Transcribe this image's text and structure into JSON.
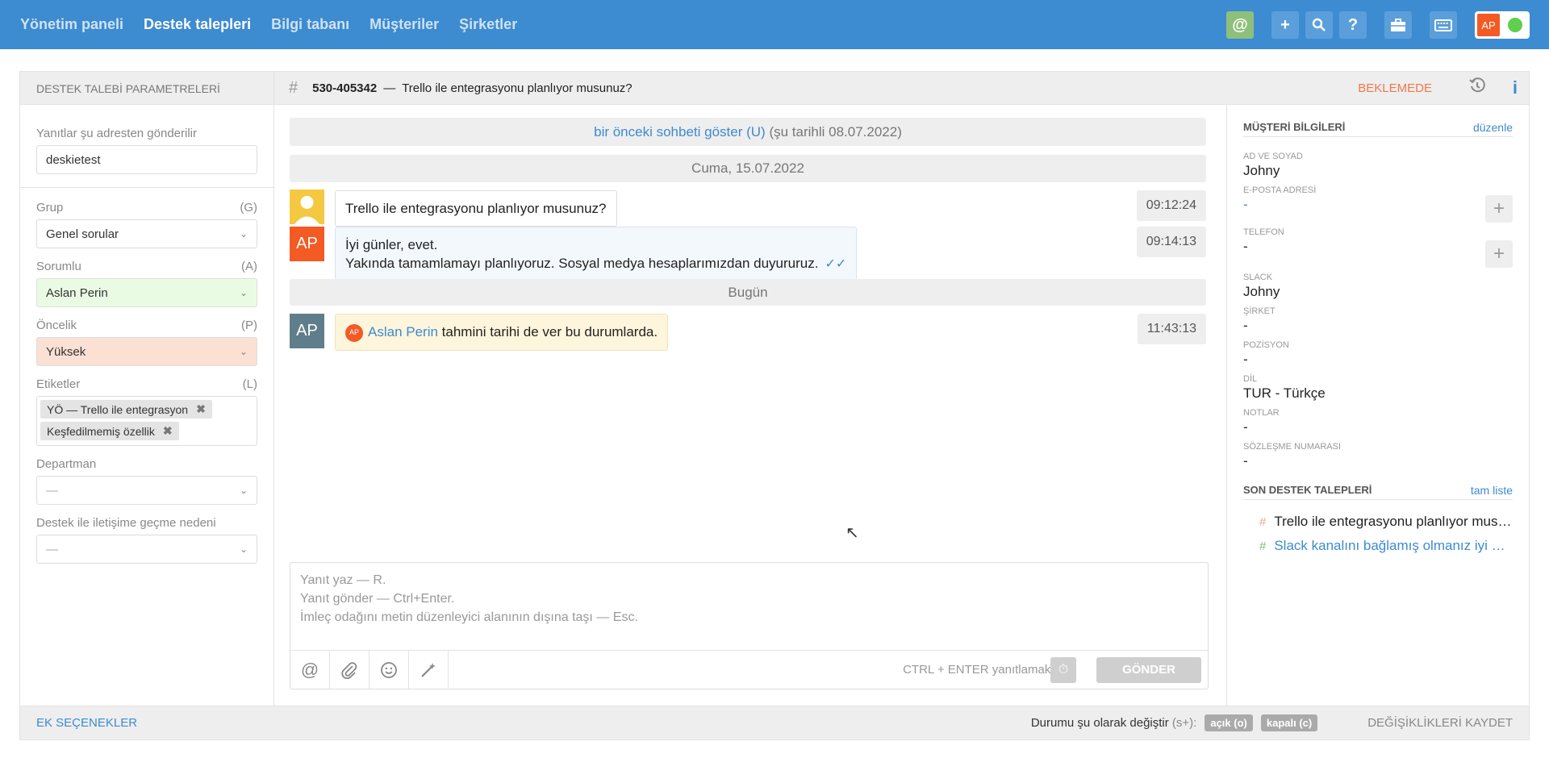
{
  "nav": {
    "items": [
      "Yönetim paneli",
      "Destek talepleri",
      "Bilgi tabanı",
      "Müşteriler",
      "Şirketler"
    ],
    "active": "Destek talepleri"
  },
  "topbar": {
    "user_initials": "AP",
    "icons": [
      "at-icon",
      "plus-icon",
      "search-icon",
      "help-icon",
      "briefcase-icon",
      "keyboard-icon"
    ],
    "online_color": "#5ecf4e",
    "brand_color": "#3d8bd0"
  },
  "left": {
    "header": "DESTEK TALEBİ PARAMETRELERİ",
    "reply_from_label": "Yanıtlar şu adresten gönderilir",
    "reply_from_value": "deskietest",
    "group_label": "Grup",
    "group_key": "(G)",
    "group_value": "Genel sorular",
    "assignee_label": "Sorumlu",
    "assignee_key": "(A)",
    "assignee_value": "Aslan Perin",
    "priority_label": "Öncelik",
    "priority_key": "(P)",
    "priority_value": "Yüksek",
    "tags_label": "Etiketler",
    "tags_key": "(L)",
    "tags": [
      "YÖ — Trello ile entegrasyon",
      "Keşfedilmemiş özellik"
    ],
    "department_label": "Departman",
    "department_value": "—",
    "reason_label": "Destek ile iletişime geçme nedeni",
    "reason_value": "—",
    "footer": "EK SEÇENEKLER"
  },
  "ticket": {
    "id": "530-405342",
    "separator": "—",
    "title": "Trello ile entegrasyonu planlıyor musunuz?",
    "status": "BEKLEMEDE"
  },
  "chat": {
    "prev_link": "bir önceki sohbeti göster (U)",
    "prev_date": "(şu tarihli 08.07.2022)",
    "date1": "Cuma, 15.07.2022",
    "date2": "Bugün",
    "messages": [
      {
        "text": "Trello ile entegrasyonu planlıyor musunuz?",
        "time": "09:12:24"
      },
      {
        "initials": "AP",
        "line1": "İyi günler, evet.",
        "line2": "Yakında tamamlamayı planlıyoruz. Sosyal medya hesaplarımızdan duyururuz.",
        "time": "09:14:13"
      },
      {
        "initials": "AP",
        "mini": "AP",
        "mention": "Aslan Perin",
        "text": "tahmini tarihi de ver bu durumlarda.",
        "time": "11:43:13"
      }
    ]
  },
  "composer": {
    "ph1": "Yanıt yaz — R.",
    "ph2": "Yanıt gönder — Ctrl+Enter.",
    "ph3": "İmleç odağını metin düzenleyici alanının dışına taşı — Esc.",
    "hint": "CTRL + ENTER yanıtlamak için",
    "send": "GÖNDER"
  },
  "customer": {
    "header": "MÜŞTERİ BİLGİLERİ",
    "edit": "düzenle",
    "fields": [
      {
        "key": "AD VE SOYAD",
        "value": "Johny"
      },
      {
        "key": "E-POSTA ADRESİ",
        "value": "-"
      },
      {
        "key": "TELEFON",
        "value": "-"
      },
      {
        "key": "SLACK",
        "value": "Johny"
      },
      {
        "key": "ŞİRKET",
        "value": "-"
      },
      {
        "key": "POZİSYON",
        "value": "-"
      },
      {
        "key": "DİL",
        "value": "TUR - Türkçe"
      },
      {
        "key": "NOTLAR",
        "value": "-"
      },
      {
        "key": "SÖZLEŞME NUMARASI",
        "value": "-"
      }
    ],
    "recent_header": "SON DESTEK TALEPLERİ",
    "recent_all": "tam liste",
    "recent": [
      "Trello ile entegrasyonu planlıyor musunuz?",
      "Slack kanalını bağlamış olmanız iyi oldu"
    ]
  },
  "bottom": {
    "change_label": "Durumu şu olarak değiştir",
    "change_key": "(s+):",
    "open": "açık (o)",
    "closed": "kapalı (c)",
    "save": "DEĞİŞİKLİKLERİ KAYDET"
  }
}
